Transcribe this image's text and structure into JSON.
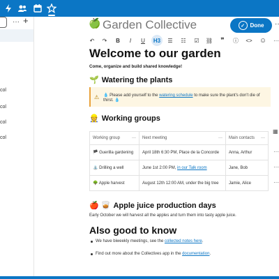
{
  "topbar": {
    "icons": [
      "lightning-icon",
      "contacts-icon",
      "calendar-icon",
      "collectives-icon"
    ],
    "color": "#0b76c5"
  },
  "sidebar": {
    "more": "···",
    "add": "+",
    "items": [
      "col",
      "col",
      "col",
      "col"
    ]
  },
  "document": {
    "emoji": "🍏",
    "title": "Garden Collective",
    "done_label": "Done",
    "more": "···"
  },
  "toolbar": {
    "undo": "↶",
    "redo": "↷",
    "bold": "B",
    "italic": "I",
    "underline": "U",
    "heading": "H3",
    "ul": "☰",
    "ol": "☷",
    "checklist": "☑",
    "link": "⛓",
    "quote": "❞",
    "info": "ⓘ",
    "code": "<>",
    "emoji": "☺",
    "more": "···"
  },
  "content": {
    "h1": "Welcome to our garden",
    "intro": "Come, organize and build shared knowledge!",
    "watering": {
      "emoji": "🌱",
      "heading": "Watering the plants",
      "callout_warn": "⚠",
      "callout_pre": "💧 Please add yourself to the ",
      "callout_link": "watering schedule",
      "callout_post": " to make sure the plant's don't die of thirst. 💧"
    },
    "groups": {
      "emoji": "👷",
      "heading": "Working groups",
      "columns": [
        "Working group",
        "Next meeting",
        "Main contacts"
      ],
      "dd": "···",
      "rows": [
        {
          "group": "🏴 Guerilla gardening",
          "meeting_pre": "April 18th 6:30 PM, Place de la Concorde",
          "meeting_link": "",
          "contacts": "Anna, Arthur"
        },
        {
          "group": "⛲ Drilling a well",
          "meeting_pre": "June 1st 2:00 PM, ",
          "meeting_link": "in our Talk room",
          "contacts": "Jane, Bob"
        },
        {
          "group": "🌳 Apple harvest",
          "meeting_pre": "August 12th 12:00 AM, under the big tree",
          "meeting_link": "",
          "contacts": "Jamie, Alice"
        }
      ]
    },
    "juice": {
      "emoji": "🍎 🥃",
      "heading": "Apple juice production days",
      "text": "Early October we will harvest all the apples and turn them into tasty apple juice."
    },
    "good": {
      "heading": "Also good to know",
      "item1_pre": "We have biweekly meetings, see the ",
      "item1_link": "collected notes here",
      "item1_post": ".",
      "item2_pre": "Find out more about the Collectives app in the ",
      "item2_link": "documentation",
      "item2_post": "."
    }
  }
}
